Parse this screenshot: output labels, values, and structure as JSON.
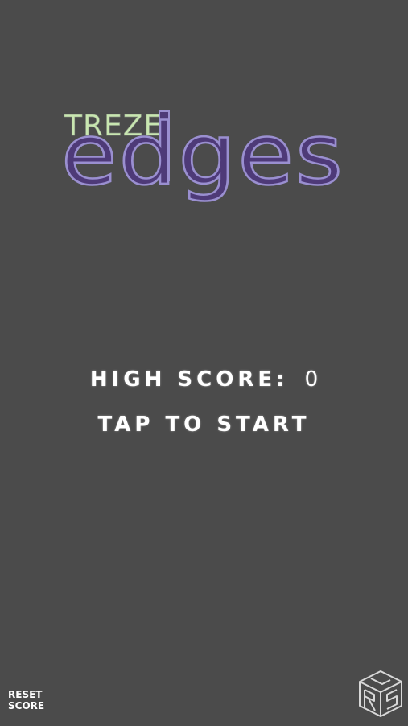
{
  "logo": {
    "top_word": "TREZE",
    "main_word": "edges",
    "top_color": "#c8e6b0",
    "main_color": "#4e3a78",
    "outline_color": "#9a8fd0"
  },
  "menu": {
    "high_score_label": "HIGH SCORE:",
    "high_score_value": "0",
    "tap_to_start": "TAP TO START"
  },
  "reset_button": {
    "line1": "RESET",
    "line2": "SCORE"
  },
  "icons": {
    "corner_logo": "cube-logo-icon"
  },
  "colors": {
    "background": "#4b4b4b",
    "text": "#ffffff"
  }
}
